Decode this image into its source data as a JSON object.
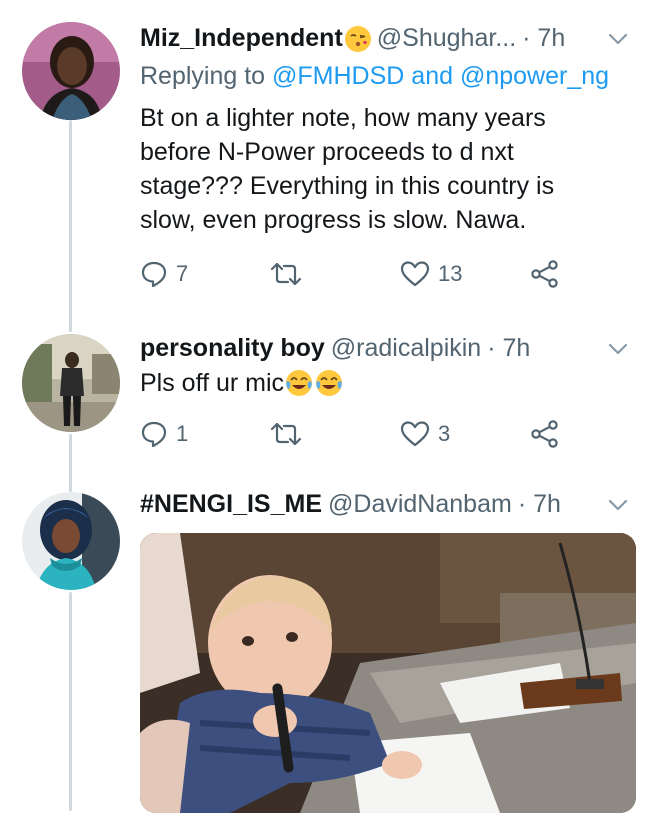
{
  "tweets": [
    {
      "name": "Miz_Independent",
      "handle": "@Shughar...",
      "time": "· 7h",
      "reply_prefix": "Replying to",
      "reply_user_1": "@FMHDSD",
      "reply_and": "and",
      "reply_user_2": "@npower_ng",
      "lines": [
        "Bt on a lighter note, how many years",
        "before N-Power proceeds to d nxt",
        "stage??? Everything in this country is",
        "slow, even progress is slow. Nawa."
      ],
      "replies": "7",
      "likes": "13"
    },
    {
      "name": "personality boy",
      "handle": "@radicalpikin",
      "time": "· 7h",
      "text": "Pls off ur mic",
      "replies": "1",
      "likes": "3"
    },
    {
      "name": "#NENGI_IS_ME",
      "handle": "@DavidNanbam",
      "time": "· 7h"
    }
  ],
  "icons": {
    "reply": "reply-icon",
    "retweet": "retweet-icon",
    "like": "heart-icon",
    "share": "share-icon",
    "more": "chevron-down-icon"
  },
  "colors": {
    "link": "#1d9bf0",
    "secondary": "#536471",
    "primary": "#14171a",
    "thread_line": "#cfd9de"
  }
}
